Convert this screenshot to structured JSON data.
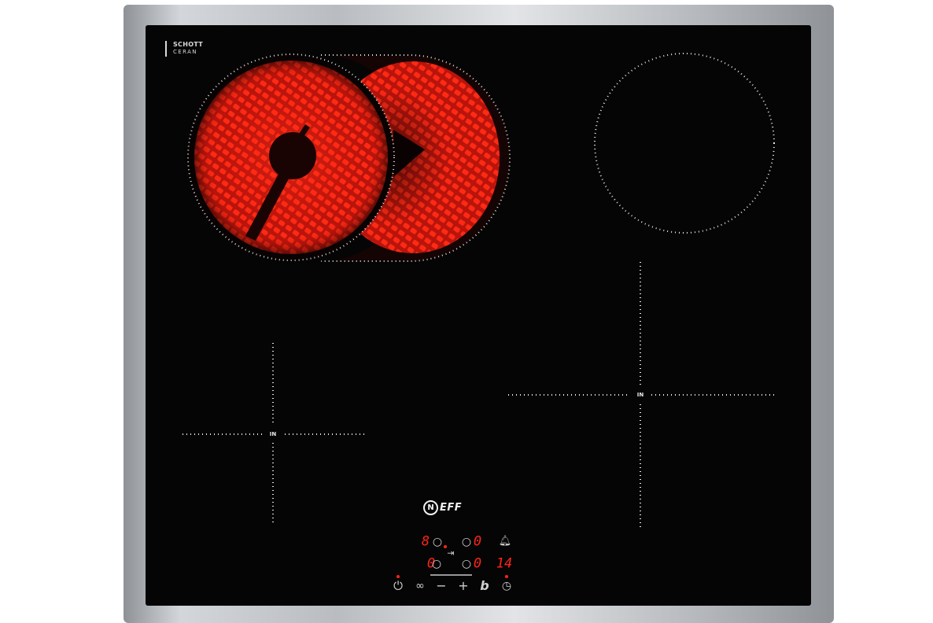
{
  "glass_logo": {
    "line1": "SCHOTT",
    "line2": "CERAN"
  },
  "zone_labels": {
    "left_induction": "IN",
    "right_induction": "IN"
  },
  "brand": {
    "mark": "N",
    "name": "EFF"
  },
  "controls": {
    "row1": {
      "left_digit": "8",
      "left_zero": "0",
      "right_zero": "0"
    },
    "row2": {
      "left_digit": "0",
      "left_zero": "0",
      "right_zero": "0",
      "timer": "14"
    },
    "icons": {
      "bell": "bell-icon",
      "skip": "skip-next-icon",
      "power": "power-icon",
      "link": "link-icon",
      "minus": "minus-icon",
      "plus": "plus-icon",
      "boost": "boost-icon",
      "clock": "clock-icon"
    },
    "glyphs": {
      "minus": "−",
      "plus": "+",
      "boost": "b",
      "skip": "⇥"
    }
  },
  "colors": {
    "glass": "#050505",
    "heat": "#ff1a0c",
    "display": "#ff2418",
    "frame": "#c7cacd"
  }
}
